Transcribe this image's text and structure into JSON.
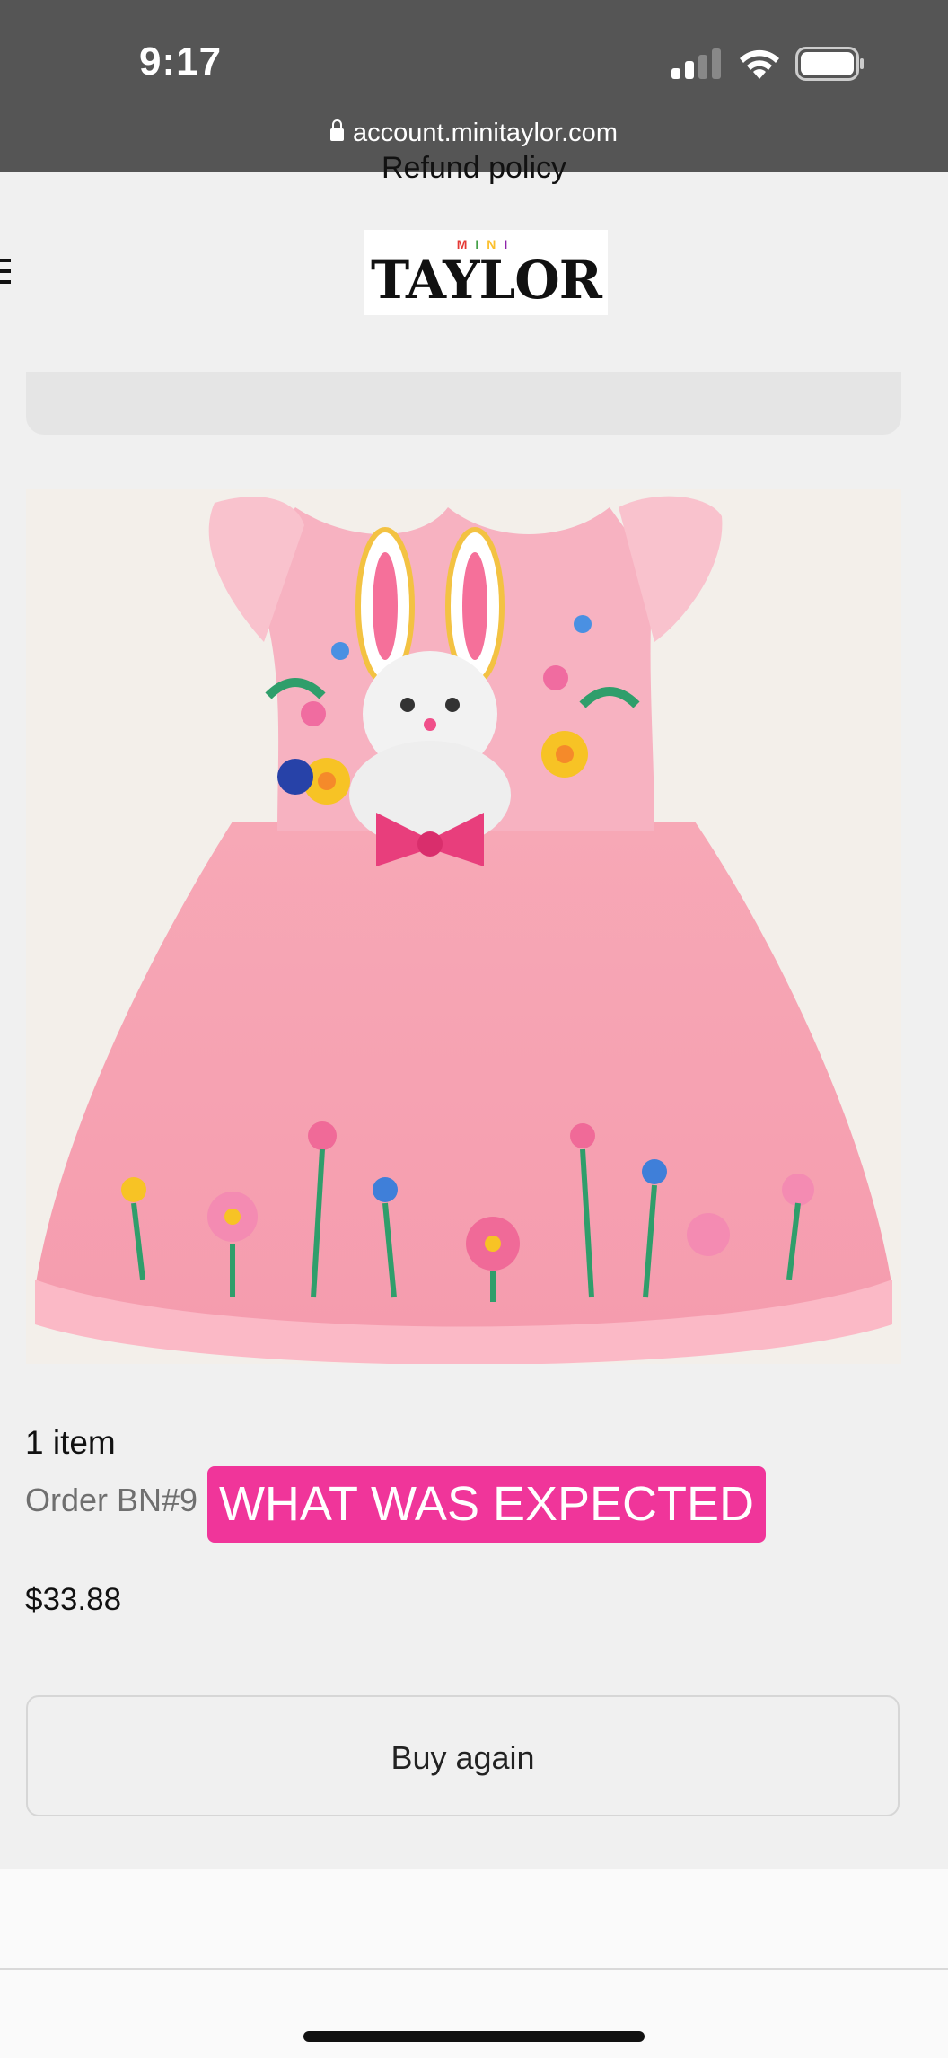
{
  "status_bar": {
    "time": "9:17"
  },
  "browser": {
    "url": "account.minitaylor.com"
  },
  "brand": {
    "logo_top": "MINI",
    "logo_main": "TAYLOR"
  },
  "product": {
    "image_alt": "Pink tulle dress with embroidered bunny and flowers"
  },
  "order": {
    "item_count": "1 item",
    "order_label": "Order BN#9",
    "price": "$33.88"
  },
  "overlay": {
    "badge": "WHAT WAS EXPECTED"
  },
  "actions": {
    "buy_again": "Buy again"
  },
  "footer": {
    "refund_policy": "Refund policy"
  },
  "colors": {
    "status_bar_bg": "#555555",
    "badge_bg": "#f0359a",
    "dress_pink": "#f8a6b8",
    "logo_m": "#e53935",
    "logo_i1": "#43a047",
    "logo_n": "#fbc02d",
    "logo_i2": "#8e24aa"
  }
}
